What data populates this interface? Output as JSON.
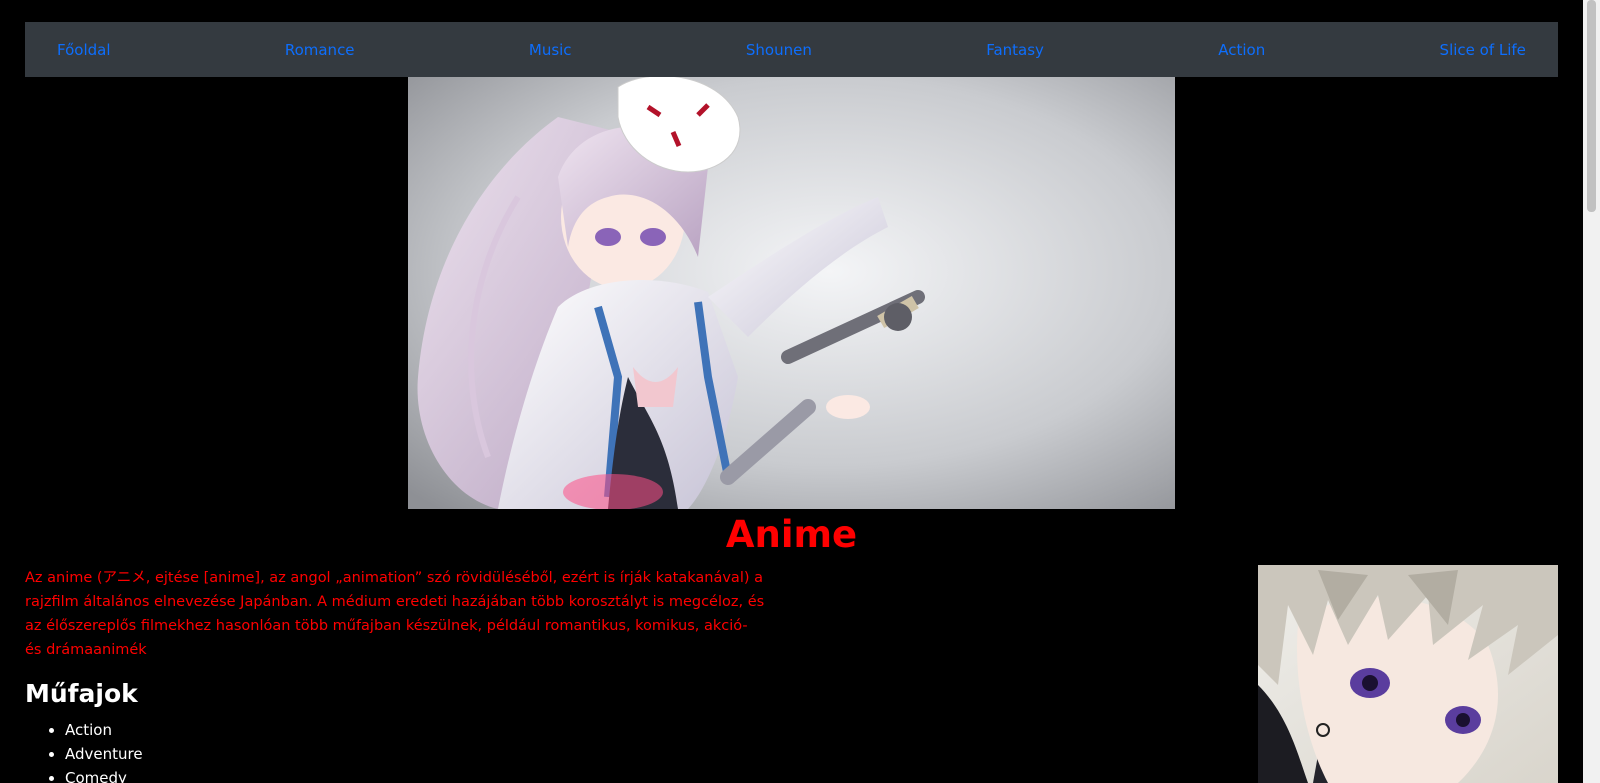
{
  "nav": {
    "items": [
      {
        "label": "Főoldal"
      },
      {
        "label": "Romance"
      },
      {
        "label": "Music"
      },
      {
        "label": "Shounen"
      },
      {
        "label": "Fantasy"
      },
      {
        "label": "Action"
      },
      {
        "label": "Slice of Life"
      }
    ]
  },
  "main": {
    "title": "Anime",
    "intro": "Az anime (アニメ, ejtése [anime], az angol „animation” szó rövidüléséből, ezért is írják katakanával) a rajzfilm általános elnevezése Japánban. A médium eredeti hazájában több korosztályt is megcéloz, és az élőszereplős filmekhez hasonlóan több műfajban készülnek, például romantikus, komikus, akció- és drámaanimék",
    "genres_heading": "Műfajok",
    "genres": [
      "Action",
      "Adventure",
      "Comedy"
    ]
  },
  "colors": {
    "background": "#000000",
    "navbar": "#343a40",
    "link": "#0d6efd",
    "accent_text": "#ff0000",
    "body_text": "#ffffff"
  }
}
